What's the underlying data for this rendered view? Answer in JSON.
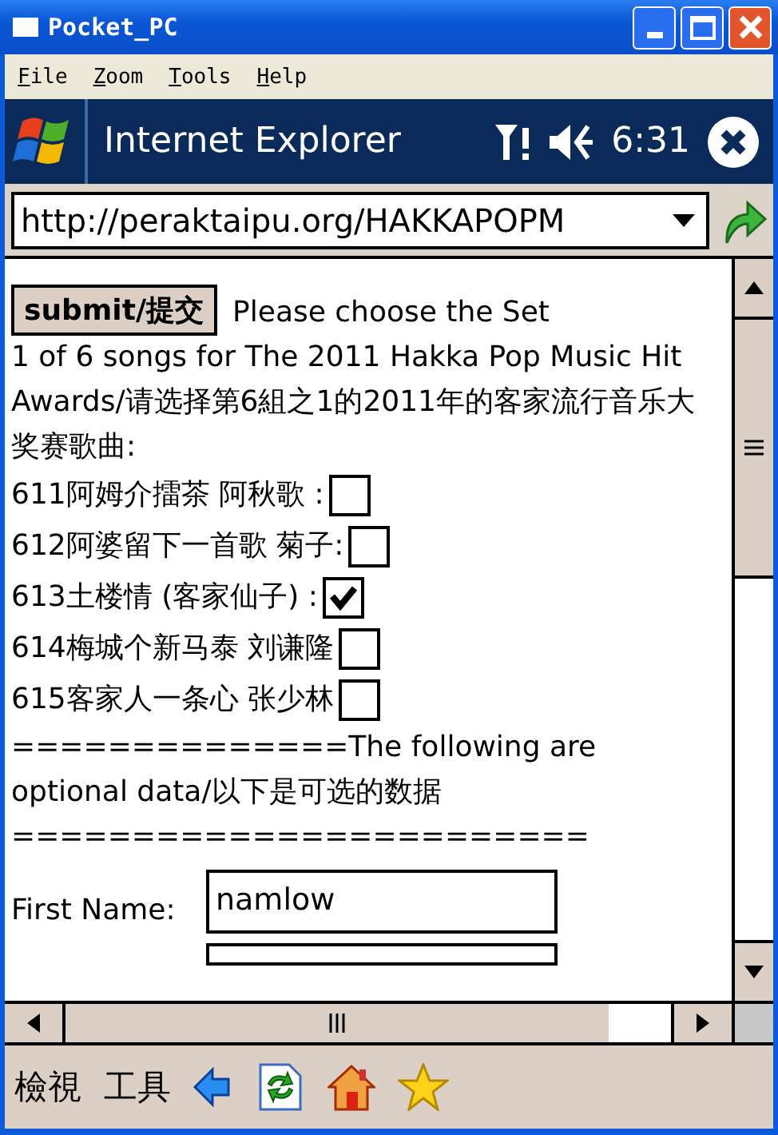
{
  "window": {
    "title": "Pocket_PC"
  },
  "menu": [
    "File",
    "Zoom",
    "Tools",
    "Help"
  ],
  "browser": {
    "title": "Internet Explorer",
    "time": "6:31",
    "address": "http://peraktaipu.org/HAKKAPOPM"
  },
  "form": {
    "submit": "submit/提交",
    "intro": [
      "Please choose the Set",
      "1 of 6 songs for The 2011 Hakka Pop Music Hit Awards/请选择第6組之1的2011年的客家流行音乐大奖赛歌曲:"
    ],
    "songs": [
      {
        "label": "611阿姆介擂茶 阿秋歌 :",
        "checked": false
      },
      {
        "label": "612阿婆留下一首歌 菊子:",
        "checked": false
      },
      {
        "label": "613土楼情 (客家仙子) :",
        "checked": true
      },
      {
        "label": "614梅城个新马泰 刘谦隆",
        "checked": false
      },
      {
        "label": "615客家人一条心 张少林",
        "checked": false
      }
    ],
    "separator": "==============The following are optional data/以下是可选的数据========================",
    "fields": [
      {
        "label": "First Name:",
        "value": "namlow"
      }
    ]
  },
  "command_bar": {
    "menus": [
      "檢視",
      "工具"
    ]
  }
}
